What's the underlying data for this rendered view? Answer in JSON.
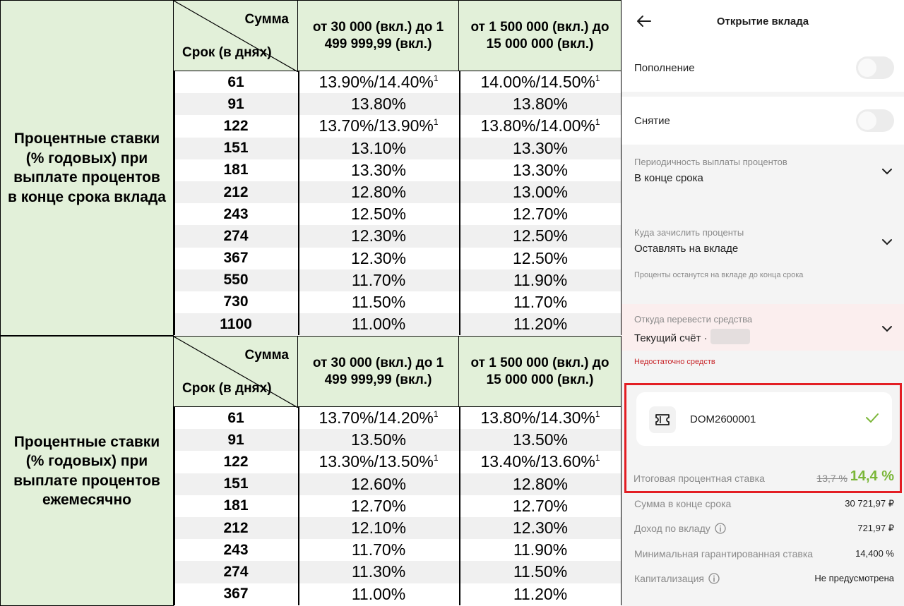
{
  "rate_tables": [
    {
      "side_label": "Процентные ставки (% годовых) при выплате процентов в конце срока вклада",
      "header": {
        "amount_label": "Сумма",
        "term_label": "Срок (в днях)",
        "col1": "от 30 000 (вкл.) до 1 499 999,99 (вкл.)",
        "col2": "от 1 500 000 (вкл.) до 15 000 000 (вкл.)"
      },
      "rows": [
        {
          "term": "61",
          "v1": "13.90%/14.40%",
          "v1_note": "1",
          "v2": "14.00%/14.50%",
          "v2_note": "1"
        },
        {
          "term": "91",
          "v1": "13.80%",
          "v1_note": "",
          "v2": "13.80%",
          "v2_note": ""
        },
        {
          "term": "122",
          "v1": "13.70%/13.90%",
          "v1_note": "1",
          "v2": "13.80%/14.00%",
          "v2_note": "1"
        },
        {
          "term": "151",
          "v1": "13.10%",
          "v1_note": "",
          "v2": "13.30%",
          "v2_note": ""
        },
        {
          "term": "181",
          "v1": "13.30%",
          "v1_note": "",
          "v2": "13.30%",
          "v2_note": ""
        },
        {
          "term": "212",
          "v1": "12.80%",
          "v1_note": "",
          "v2": "13.00%",
          "v2_note": ""
        },
        {
          "term": "243",
          "v1": "12.50%",
          "v1_note": "",
          "v2": "12.70%",
          "v2_note": ""
        },
        {
          "term": "274",
          "v1": "12.30%",
          "v1_note": "",
          "v2": "12.50%",
          "v2_note": ""
        },
        {
          "term": "367",
          "v1": "12.30%",
          "v1_note": "",
          "v2": "12.50%",
          "v2_note": ""
        },
        {
          "term": "550",
          "v1": "11.70%",
          "v1_note": "",
          "v2": "11.90%",
          "v2_note": ""
        },
        {
          "term": "730",
          "v1": "11.50%",
          "v1_note": "",
          "v2": "11.70%",
          "v2_note": ""
        },
        {
          "term": "1100",
          "v1": "11.00%",
          "v1_note": "",
          "v2": "11.20%",
          "v2_note": ""
        }
      ]
    },
    {
      "side_label": "Процентные ставки (% годовых) при выплате процентов ежемесячно",
      "header": {
        "amount_label": "Сумма",
        "term_label": "Срок (в днях)",
        "col1": "от 30 000 (вкл.) до 1 499 999,99 (вкл.)",
        "col2": "от 1 500 000 (вкл.) до 15 000 000 (вкл.)"
      },
      "rows": [
        {
          "term": "61",
          "v1": "13.70%/14.20%",
          "v1_note": "1",
          "v2": "13.80%/14.30%",
          "v2_note": "1"
        },
        {
          "term": "91",
          "v1": "13.50%",
          "v1_note": "",
          "v2": "13.50%",
          "v2_note": ""
        },
        {
          "term": "122",
          "v1": "13.30%/13.50%",
          "v1_note": "1",
          "v2": "13.40%/13.60%",
          "v2_note": "1"
        },
        {
          "term": "151",
          "v1": "12.60%",
          "v1_note": "",
          "v2": "12.80%",
          "v2_note": ""
        },
        {
          "term": "181",
          "v1": "12.70%",
          "v1_note": "",
          "v2": "12.70%",
          "v2_note": ""
        },
        {
          "term": "212",
          "v1": "12.10%",
          "v1_note": "",
          "v2": "12.30%",
          "v2_note": ""
        },
        {
          "term": "243",
          "v1": "11.70%",
          "v1_note": "",
          "v2": "11.90%",
          "v2_note": ""
        },
        {
          "term": "274",
          "v1": "11.30%",
          "v1_note": "",
          "v2": "11.50%",
          "v2_note": ""
        },
        {
          "term": "367",
          "v1": "11.00%",
          "v1_note": "",
          "v2": "11.20%",
          "v2_note": ""
        }
      ]
    }
  ],
  "app": {
    "title": "Открытие вклада",
    "back_icon": "arrow-left-icon",
    "replenish_label": "Пополнение",
    "withdraw_label": "Снятие",
    "interest_period": {
      "caption": "Периодичность выплаты процентов",
      "value": "В конце срока"
    },
    "interest_target": {
      "caption": "Куда зачислить проценты",
      "value": "Оставлять на вкладе",
      "hint": "Проценты останутся на вкладе до конца срока"
    },
    "source": {
      "caption": "Откуда перевести средства",
      "value": "Текущий счёт ·",
      "error": "Недостаточно средств"
    },
    "promo": {
      "code": "DOM2600001",
      "icon": "ticket-icon",
      "check_icon": "check-icon"
    },
    "final_rate": {
      "label": "Итоговая процентная ставка",
      "old": "13,7 %",
      "new": "14,4 %"
    },
    "summary": [
      {
        "key": "Сумма в конце срока",
        "value": "30 721,97 ₽",
        "info": false
      },
      {
        "key": "Доход по вкладу",
        "value": "721,97 ₽",
        "info": true
      },
      {
        "key": "Минимальная гарантированная ставка",
        "value": "14,400 %",
        "info": false
      },
      {
        "key": "Капитализация",
        "value": "Не предусмотрена",
        "info": true
      }
    ],
    "colors": {
      "accent_green": "#7ab637",
      "error_red": "#c8282c",
      "highlight_border": "#e31e24",
      "table_header_bg": "#e2f0d9"
    }
  }
}
